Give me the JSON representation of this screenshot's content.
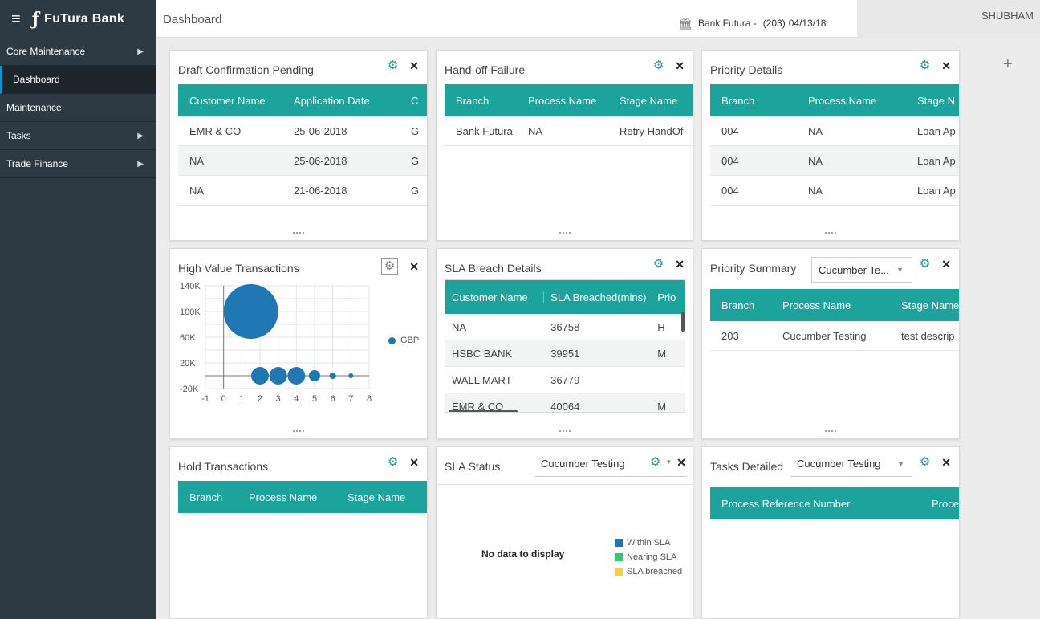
{
  "app": {
    "brand": "FuTura Bank",
    "breadcrumb": "Dashboard",
    "bank_name": "Bank Futura -",
    "branch_code": "(203)",
    "date": "04/13/18",
    "user": "SHUBHAM"
  },
  "sidebar": {
    "items": [
      {
        "label": "Core Maintenance",
        "has_arrow": true
      },
      {
        "label": "Dashboard",
        "has_arrow": false,
        "active": true
      },
      {
        "label": "Maintenance",
        "has_arrow": false
      },
      {
        "label": "Tasks",
        "has_arrow": true
      },
      {
        "label": "Trade Finance",
        "has_arrow": true
      }
    ]
  },
  "widgets": {
    "draft": {
      "title": "Draft Confirmation Pending",
      "columns": [
        "Customer Name",
        "Application Date",
        "C"
      ],
      "rows": [
        [
          "EMR & CO",
          "25-06-2018",
          "G"
        ],
        [
          "NA",
          "25-06-2018",
          "G"
        ],
        [
          "NA",
          "21-06-2018",
          "G"
        ]
      ]
    },
    "handoff": {
      "title": "Hand-off Failure",
      "columns": [
        "Branch",
        "Process Name",
        "Stage Name"
      ],
      "rows": [
        [
          "Bank Futura",
          "NA",
          "Retry HandOf"
        ]
      ]
    },
    "priority_details": {
      "title": "Priority Details",
      "columns": [
        "Branch",
        "Process Name",
        "Stage N"
      ],
      "rows": [
        [
          "004",
          "NA",
          "Loan Ap"
        ],
        [
          "004",
          "NA",
          "Loan Ap"
        ],
        [
          "004",
          "NA",
          "Loan Ap"
        ]
      ]
    },
    "hvt": {
      "title": "High Value Transactions",
      "legend": "GBP"
    },
    "sla_breach": {
      "title": "SLA Breach Details",
      "columns": [
        "Customer Name",
        "SLA Breached(mins)",
        "Prio"
      ],
      "rows": [
        [
          "NA",
          "36758",
          "H"
        ],
        [
          "HSBC BANK",
          "39951",
          "M"
        ],
        [
          "WALL MART",
          "36779",
          ""
        ],
        [
          "EMR & CO",
          "40064",
          "M"
        ]
      ]
    },
    "priority_summary": {
      "title": "Priority Summary",
      "dropdown": "Cucumber Te...",
      "columns": [
        "Branch",
        "Process Name",
        "Stage Name"
      ],
      "rows": [
        [
          "203",
          "Cucumber Testing",
          "test descrip"
        ]
      ]
    },
    "hold": {
      "title": "Hold Transactions",
      "columns": [
        "Branch",
        "Process Name",
        "Stage Name"
      ]
    },
    "sla_status": {
      "title": "SLA Status",
      "dropdown": "Cucumber Testing",
      "no_data": "No data to display",
      "legend": [
        {
          "label": "Within SLA",
          "color": "#1f77b4"
        },
        {
          "label": "Nearing SLA",
          "color": "#2ecc71"
        },
        {
          "label": "SLA breached",
          "color": "#f4d03f"
        }
      ]
    },
    "tasks": {
      "title": "Tasks Detailed",
      "dropdown": "Cucumber Testing",
      "columns": [
        "Process Reference Number",
        "Proce"
      ]
    }
  },
  "chart_data": {
    "type": "scatter",
    "title": "",
    "series": [
      {
        "name": "GBP",
        "points": [
          {
            "x": 1.5,
            "y": 100000,
            "r": 34
          },
          {
            "x": 2,
            "y": 0,
            "r": 11
          },
          {
            "x": 3,
            "y": 0,
            "r": 11
          },
          {
            "x": 4,
            "y": 0,
            "r": 11
          },
          {
            "x": 5,
            "y": 0,
            "r": 7
          },
          {
            "x": 6,
            "y": 0,
            "r": 4
          },
          {
            "x": 7,
            "y": 0,
            "r": 3
          }
        ]
      }
    ],
    "x_ticks": [
      "-1",
      "0",
      "1",
      "2",
      "3",
      "4",
      "5",
      "6",
      "7",
      "8"
    ],
    "y_ticks": [
      "140K",
      "100K",
      "60K",
      "20K",
      "-20K"
    ],
    "xlim": [
      -1,
      8
    ],
    "ylim": [
      -20000,
      140000
    ],
    "color": "#1f77b4",
    "grid": true,
    "legend": "right"
  }
}
